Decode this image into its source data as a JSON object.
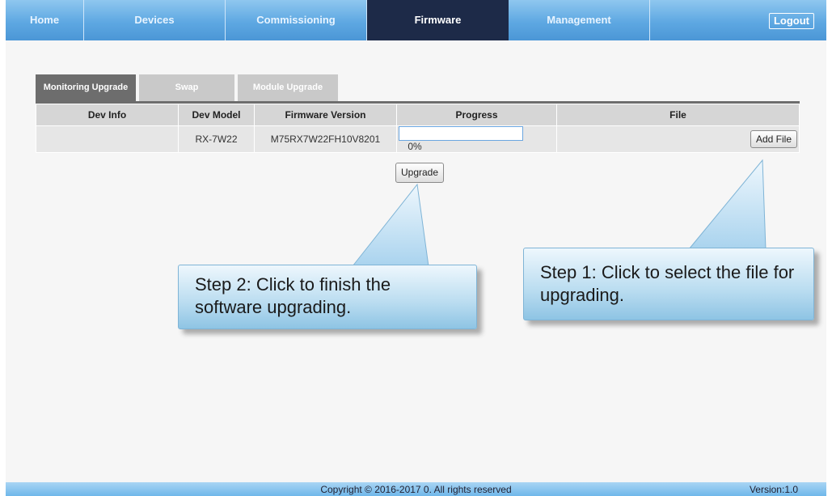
{
  "nav": {
    "tabs": [
      "Home",
      "Devices",
      "Commissioning",
      "Firmware",
      "Management"
    ],
    "active": "Firmware",
    "logout": "Logout"
  },
  "subtabs": [
    "Monitoring Upgrade",
    "Swap",
    "Module Upgrade"
  ],
  "table": {
    "headers": [
      "Dev Info",
      "Dev Model",
      "Firmware Version",
      "Progress",
      "File"
    ],
    "row": {
      "dev_info": "",
      "dev_model": "RX-7W22",
      "firmware_version": "M75RX7W22FH10V8201",
      "progress_text": "0%",
      "progress_value": 0,
      "add_file": "Add File"
    }
  },
  "upgrade_button": "Upgrade",
  "callouts": {
    "step2": "Step 2: Click to finish the software upgrading.",
    "step1": "Step 1: Click to select the file for upgrading."
  },
  "footer": {
    "copyright": "Copyright © 2016-2017 0. All rights reserved",
    "version": "Version:1.0"
  }
}
